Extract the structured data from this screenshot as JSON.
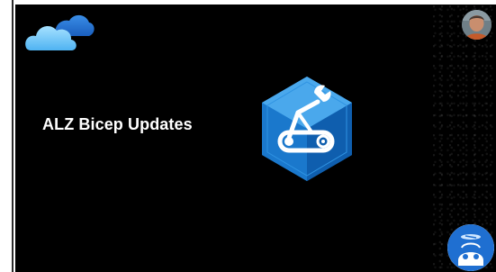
{
  "slide": {
    "title": "ALZ Bicep Updates"
  },
  "icons": {
    "top_left": "azure-cloud-icon",
    "center": "bicep-arm-icon",
    "top_right": "presenter-avatar",
    "bottom_right": "robot-avatar"
  },
  "colors": {
    "slide_background": "#000000",
    "title_text": "#ffffff",
    "cloud_light": "#7fd0ff",
    "cloud_dark": "#1a74d4",
    "bicep_front": "#1e88d8",
    "bicep_dark": "#0f5aa6",
    "bicep_light": "#59b4f0",
    "avatar_blue": "#1f6fd1"
  }
}
